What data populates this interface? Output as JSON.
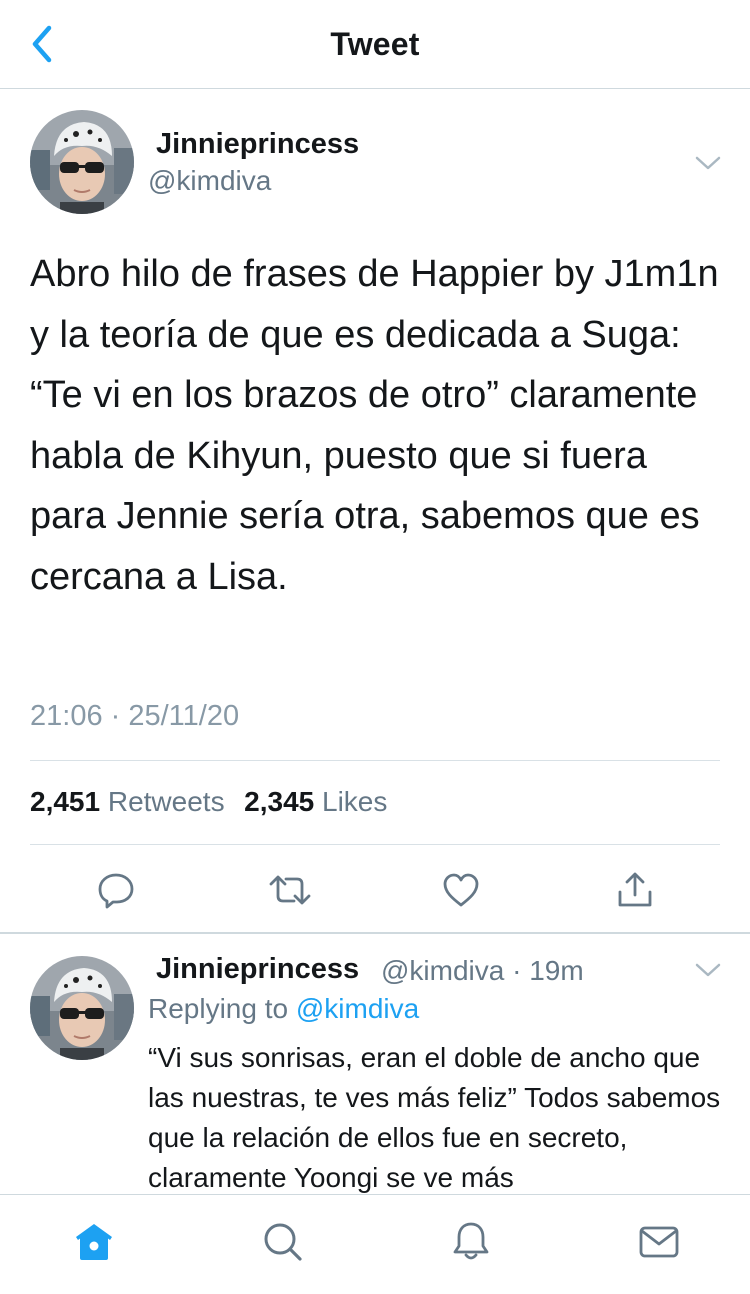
{
  "header": {
    "title": "Tweet"
  },
  "tweet": {
    "display_name": "Jinnieprincess",
    "handle": "@kimdiva",
    "text": "Abro hilo de frases de Happier by J1m1n y la teoría de que es dedicada a Suga:\n“Te vi en los brazos de otro” claramente habla de Kihyun, puesto que si fuera para Jennie sería otra, sabemos que es cercana a Lisa.",
    "timestamp": "21:06 · 25/11/20",
    "retweets_count": "2,451",
    "retweets_label": "Retweets",
    "likes_count": "2,345",
    "likes_label": "Likes"
  },
  "actions": {
    "reply_icon": "reply-icon",
    "retweet_icon": "retweet-icon",
    "like_icon": "heart-icon",
    "share_icon": "share-icon"
  },
  "reply": {
    "display_name": "Jinnieprincess",
    "meta": "@kimdiva · 19m",
    "replying_prefix": "Replying to",
    "replying_handle": "@kimdiva",
    "text": "“Vi sus sonrisas, eran el doble de ancho que las nuestras, te ves más feliz” Todos sabemos que la relación de ellos fue en secreto, claramente Yoongi se ve más"
  },
  "tabbar": {
    "items": [
      "home-icon",
      "search-icon",
      "notifications-icon",
      "messages-icon"
    ],
    "active": "home-icon"
  },
  "colors": {
    "accent": "#1da1f2",
    "text": "#14171a",
    "secondary": "#657786",
    "divider": "#cfd9de"
  }
}
